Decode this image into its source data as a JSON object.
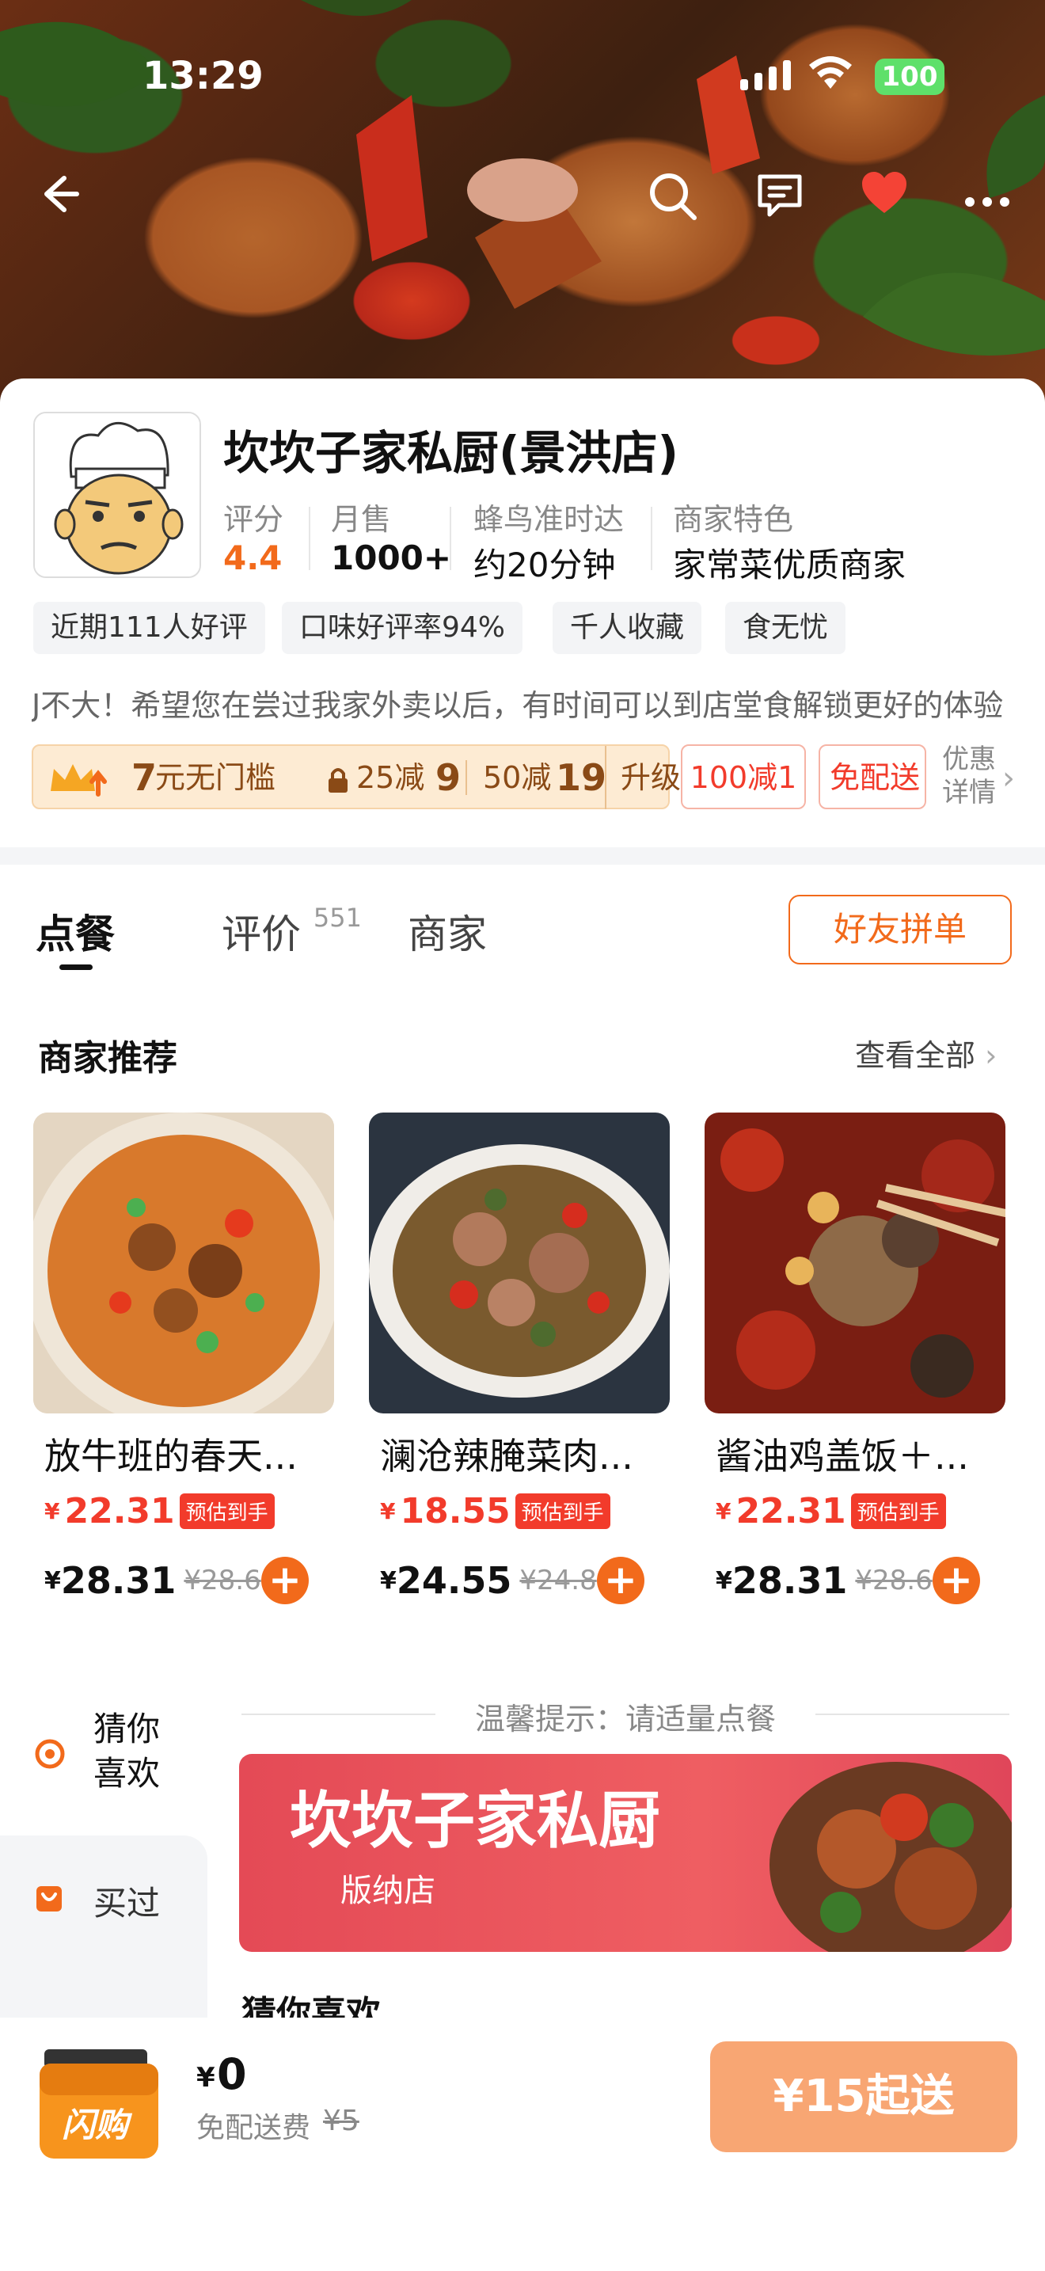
{
  "status_bar": {
    "time": "13:29",
    "battery": "100"
  },
  "header_icons": [
    "back-arrow-icon",
    "search-icon",
    "message-icon",
    "heart-icon",
    "more-icon"
  ],
  "shop": {
    "name": "坎坎子家私厨(景洪店)",
    "stats": [
      {
        "label": "评分",
        "value": "4.4"
      },
      {
        "label": "月售",
        "value": "1000+"
      },
      {
        "label": "蜂鸟准时达",
        "value": "约20分钟"
      },
      {
        "label": "商家特色",
        "value": "家常菜优质商家"
      }
    ],
    "tags": [
      "近期111人好评",
      "口味好评率94%",
      "千人收藏",
      "食无忧"
    ],
    "notice": "J不大！希望您在尝过我家外卖以后，有时间可以到店堂食解锁更好的体验"
  },
  "promos": {
    "vip_amount": "7",
    "vip_text": "元无门槛",
    "coupon1_a": "25减",
    "coupon1_b": "9",
    "coupon2_a": "50减",
    "coupon2_b": "19",
    "upgrade": "升级",
    "discount": "100减1",
    "free_delivery": "免配送",
    "details_1": "优惠",
    "details_2": "详情"
  },
  "tabs": [
    {
      "label": "点餐",
      "active": true
    },
    {
      "label": "评价",
      "count": "551"
    },
    {
      "label": "商家"
    }
  ],
  "group_order": "好友拼单",
  "recommend": {
    "title": "商家推荐",
    "see_all": "查看全部",
    "items": [
      {
        "name": "放牛班的春天...",
        "est_price": "22.31",
        "est_badge": "预估到手",
        "price": "28.31",
        "orig_price": "¥28.6"
      },
      {
        "name": "澜沧辣腌菜肉...",
        "est_price": "18.55",
        "est_badge": "预估到手",
        "price": "24.55",
        "orig_price": "¥24.8"
      },
      {
        "name": "酱油鸡盖饭＋...",
        "est_price": "22.31",
        "est_badge": "预估到手",
        "price": "28.31",
        "orig_price": "¥28.6"
      }
    ]
  },
  "sidebar": [
    {
      "label": "猜你喜欢",
      "active": true
    },
    {
      "label": "买过"
    }
  ],
  "tip": "温馨提示：请适量点餐",
  "banner": {
    "title": "坎坎子家私厨",
    "subtitle": "版纳店"
  },
  "section_partial": "猜你喜欢",
  "cart": {
    "badge": "闪购",
    "total_symbol": "¥",
    "total": "0",
    "delivery_label": "免配送费",
    "delivery_orig": "¥5",
    "min_order": "¥15起送"
  },
  "colors": {
    "accent": "#f26a1b",
    "price_red": "#f23b2b",
    "vip_gold": "#fdebd3"
  }
}
